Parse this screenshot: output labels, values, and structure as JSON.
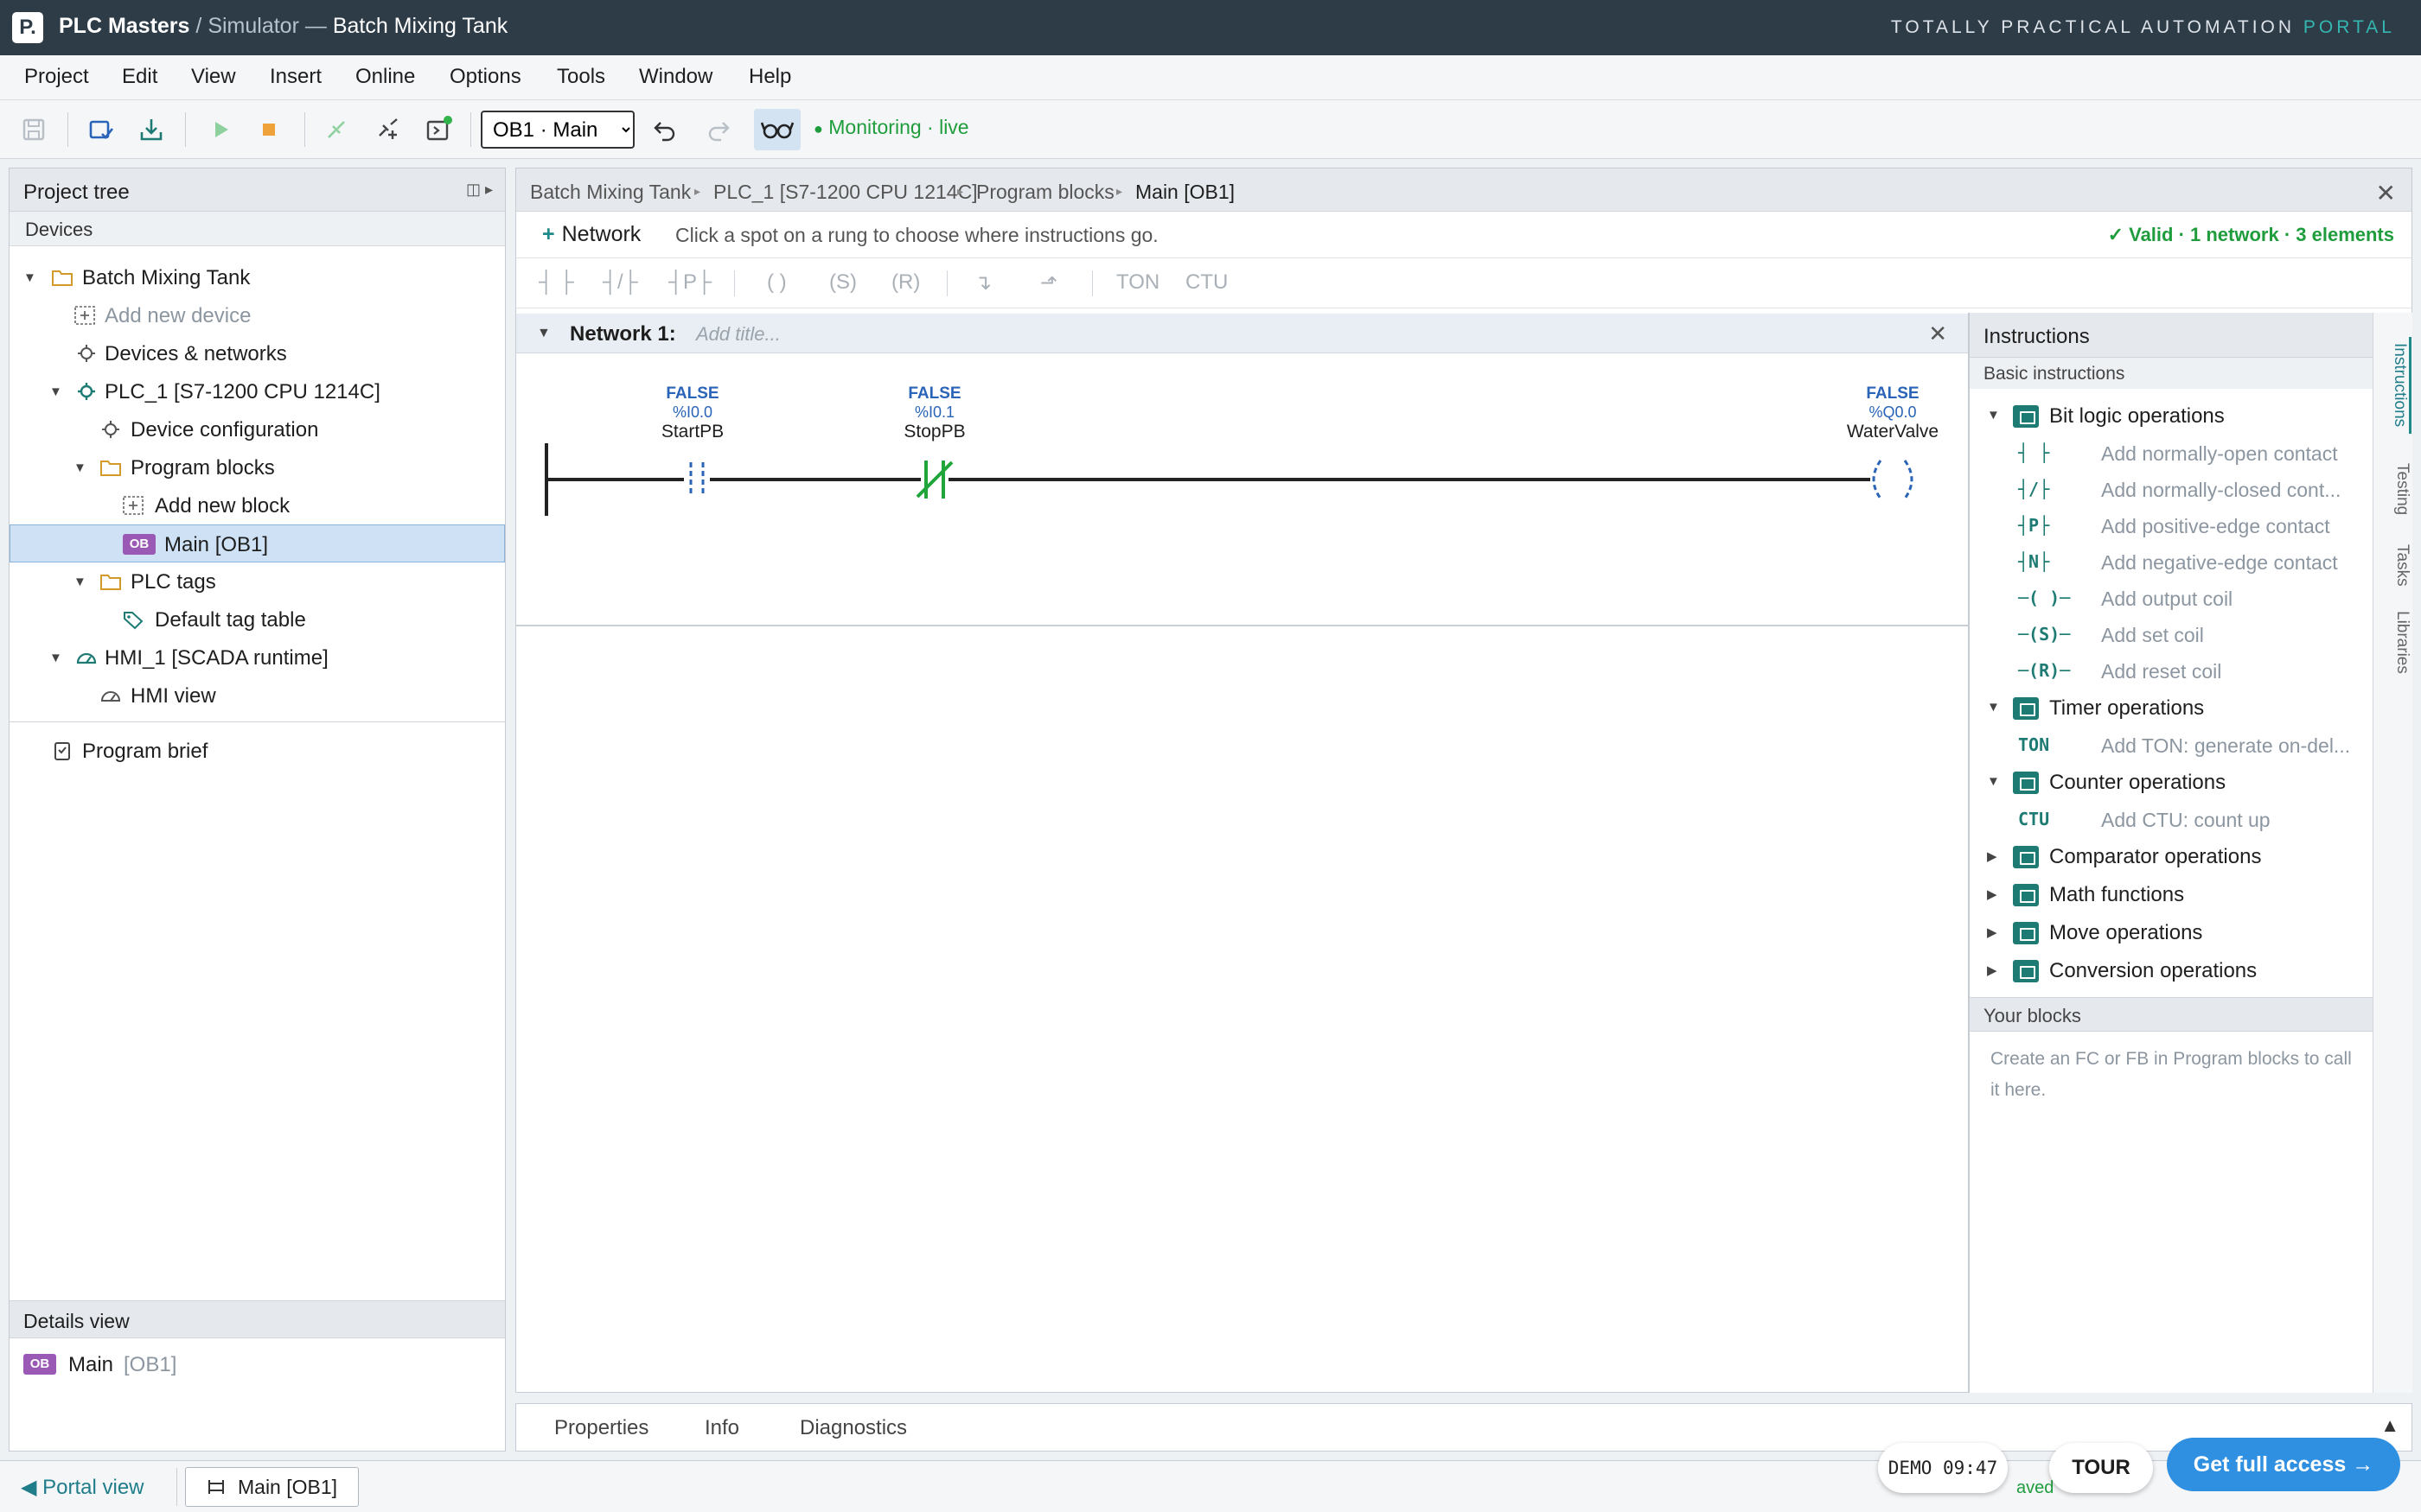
{
  "app": {
    "logo": "P.",
    "brand": "PLC Masters",
    "separator": "/",
    "section": "Simulator —",
    "project": "Batch Mixing Tank",
    "portal_prefix": "TOTALLY PRACTICAL AUTOMATION",
    "portal_suffix": "PORTAL"
  },
  "menu": [
    "Project",
    "Edit",
    "View",
    "Insert",
    "Online",
    "Options",
    "Tools",
    "Window",
    "Help"
  ],
  "toolbar": {
    "block_select": "OB1 · Main",
    "block_options": [
      "OB1 · Main"
    ],
    "monitoring_status": "Monitoring · live",
    "icons": [
      "save-icon",
      "compile-icon",
      "download-icon",
      "run-icon",
      "stop-icon",
      "go-online-icon",
      "go-offline-icon",
      "simulate-icon",
      "undo-icon",
      "redo-icon",
      "monitor-glasses-icon"
    ]
  },
  "project_tree": {
    "title": "Project tree",
    "devices_label": "Devices",
    "rows": {
      "project": "Batch Mixing Tank",
      "add_device": "Add new device",
      "devices_networks": "Devices & networks",
      "plc": "PLC_1 [S7-1200 CPU 1214C]",
      "device_config": "Device configuration",
      "program_blocks": "Program blocks",
      "add_block": "Add new block",
      "ob_badge": "OB",
      "main_block": "Main [OB1]",
      "plc_tags": "PLC tags",
      "tag_table": "Default tag table",
      "hmi": "HMI_1 [SCADA runtime]",
      "hmi_view": "HMI view",
      "brief": "Program brief"
    }
  },
  "details_view": {
    "title": "Details view",
    "badge": "OB",
    "name": "Main",
    "id": "[OB1]"
  },
  "editor": {
    "breadcrumb": [
      "Batch Mixing Tank",
      "PLC_1 [S7-1200 CPU 1214C]",
      "Program blocks",
      "Main [OB1]"
    ],
    "add_network": "Network",
    "hint": "Click a spot on a rung to choose where instructions go.",
    "validation": "✓ Valid · 1 network · 3 elements",
    "instr_bar": [
      "┤ ├",
      "┤/├",
      "┤P├",
      "( )",
      "(S)",
      "(R)",
      "↴",
      "⬏",
      "TON",
      "CTU"
    ],
    "network": {
      "title": "Network 1:",
      "title_placeholder": "Add title...",
      "elements": [
        {
          "kind": "NO contact",
          "state": "FALSE",
          "address": "%I0.0",
          "tag": "StartPB"
        },
        {
          "kind": "NC contact",
          "state": "FALSE",
          "address": "%I0.1",
          "tag": "StopPB"
        },
        {
          "kind": "Output coil",
          "state": "FALSE",
          "address": "%Q0.0",
          "tag": "WaterValve"
        }
      ]
    }
  },
  "instructions": {
    "title": "Instructions",
    "basic_label": "Basic instructions",
    "categories": {
      "bit_logic": "Bit logic operations",
      "timer": "Timer operations",
      "counter": "Counter operations",
      "comparator": "Comparator operations",
      "math": "Math functions",
      "move": "Move operations",
      "conversion": "Conversion operations"
    },
    "bit_items": [
      {
        "sym": "┤ ├",
        "label": "Add normally-open contact"
      },
      {
        "sym": "┤/├",
        "label": "Add normally-closed cont..."
      },
      {
        "sym": "┤P├",
        "label": "Add positive-edge contact"
      },
      {
        "sym": "┤N├",
        "label": "Add negative-edge contact"
      },
      {
        "sym": "─( )─",
        "label": "Add output coil"
      },
      {
        "sym": "─(S)─",
        "label": "Add set coil"
      },
      {
        "sym": "─(R)─",
        "label": "Add reset coil"
      }
    ],
    "timer_item": {
      "sym": "TON",
      "label": "Add TON: generate on-del..."
    },
    "counter_item": {
      "sym": "CTU",
      "label": "Add CTU: count up"
    },
    "your_blocks_title": "Your blocks",
    "your_blocks_text": "Create an FC or FB in Program blocks to call it here."
  },
  "side_tabs": [
    "Instructions",
    "Testing",
    "Tasks",
    "Libraries"
  ],
  "bottom_tabs": [
    "Properties",
    "Info",
    "Diagnostics"
  ],
  "statusbar": {
    "portal_view": "Portal view",
    "main_tab": "Main [OB1]",
    "saved": "aved"
  },
  "overlay": {
    "demo": "DEMO 09:47",
    "tour": "TOUR",
    "access": "Get full access →"
  },
  "colors": {
    "titlebar": "#2e3c48",
    "accent_teal": "#1f8a8a",
    "monitor_green": "#1f9d3c",
    "cta_blue": "#2f8fe0",
    "ob_badge": "#9b59b6"
  }
}
